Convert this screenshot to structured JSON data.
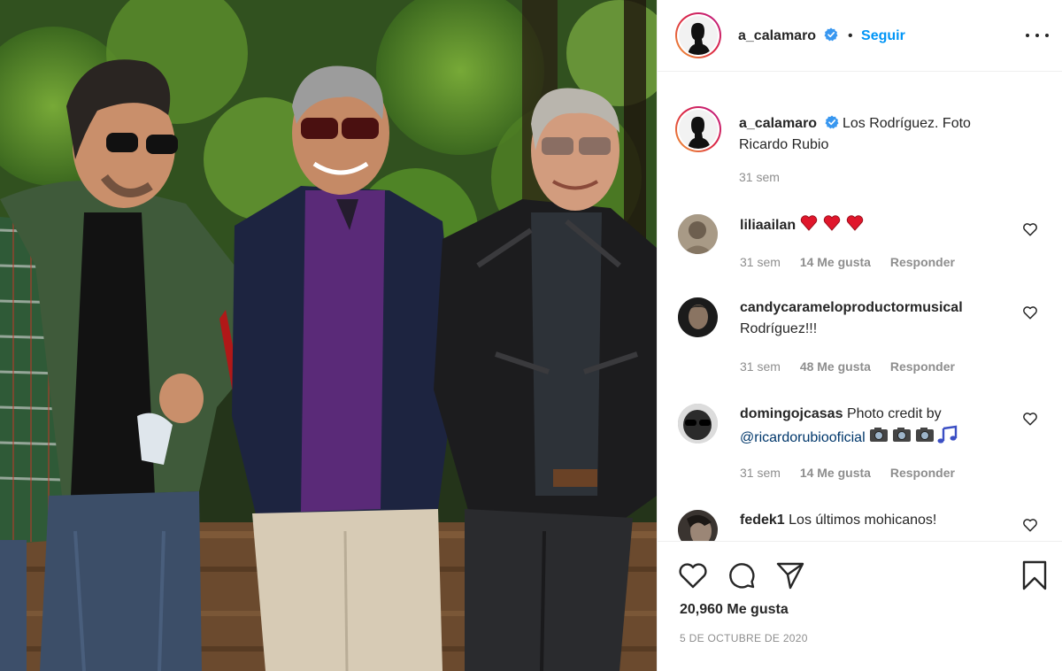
{
  "post": {
    "username": "a_calamaro",
    "follow_label": "Seguir",
    "separator": "•",
    "more_icon": "more-options-icon",
    "caption": "Los Rodríguez. Foto Ricardo Rubio",
    "caption_time": "31 sem"
  },
  "comments": [
    {
      "user": "liliaailan",
      "text": "",
      "emoji": [
        "heart",
        "heart",
        "heart"
      ],
      "time": "31 sem",
      "likes": "14 Me gusta",
      "reply": "Responder"
    },
    {
      "user": "candycarameloproductormusical",
      "text": "Rodríguez!!!",
      "time": "31 sem",
      "likes": "48 Me gusta",
      "reply": "Responder"
    },
    {
      "user": "domingojcasas",
      "text": "Photo credit by",
      "mention": "@ricardorubiooficial",
      "emoji": [
        "camera",
        "camera",
        "camera",
        "music-note"
      ],
      "time": "31 sem",
      "likes": "14 Me gusta",
      "reply": "Responder"
    },
    {
      "user": "fedek1",
      "text": "Los últimos mohicanos!"
    }
  ],
  "footer": {
    "likes_count": "20,960 Me gusta",
    "date": "5 DE OCTUBRE DE 2020",
    "icons": [
      "like-icon",
      "comment-icon",
      "share-icon",
      "save-icon"
    ]
  },
  "colors": {
    "link_blue": "#0095f6",
    "mention_blue": "#00376b",
    "muted": "#8e8e8e",
    "text": "#262626",
    "heart_red": "#ed4956"
  }
}
